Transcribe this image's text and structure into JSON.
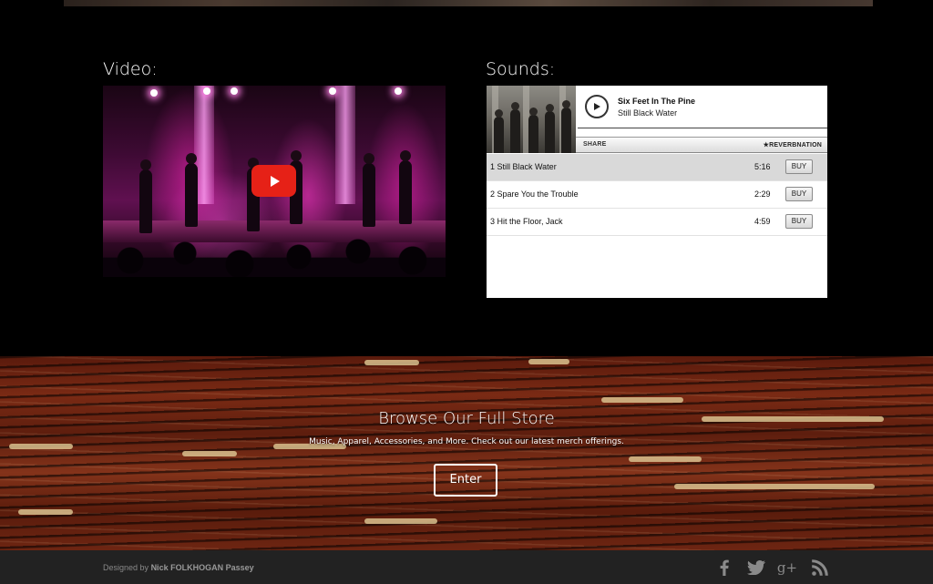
{
  "video": {
    "heading": "Video:",
    "play_icon": "youtube-play-icon"
  },
  "sounds": {
    "heading": "Sounds:",
    "player": {
      "song_title": "Six Feet In The Pine",
      "artist": "Still Black Water",
      "share_label": "SHARE",
      "brand": "★REVERBNATION",
      "tracks": [
        {
          "name": "1 Still Black Water",
          "duration": "5:16",
          "buy": "BUY"
        },
        {
          "name": "2 Spare You the Trouble",
          "duration": "2:29",
          "buy": "BUY"
        },
        {
          "name": "3 Hit the Floor, Jack",
          "duration": "4:59",
          "buy": "BUY"
        }
      ]
    }
  },
  "store": {
    "title": "Browse Our Full Store",
    "subtitle": "Music, Apparel, Accessories, and More. Check out our latest merch offerings.",
    "button": "Enter"
  },
  "footer": {
    "designed_by_prefix": "Designed by",
    "designer": "Nick FOLKHOGAN Passey",
    "social_icons": [
      "facebook-icon",
      "twitter-icon",
      "google-plus-icon",
      "rss-icon"
    ]
  },
  "colors": {
    "background": "#000000",
    "footer_bg": "#222222",
    "youtube_red": "#e62117"
  }
}
